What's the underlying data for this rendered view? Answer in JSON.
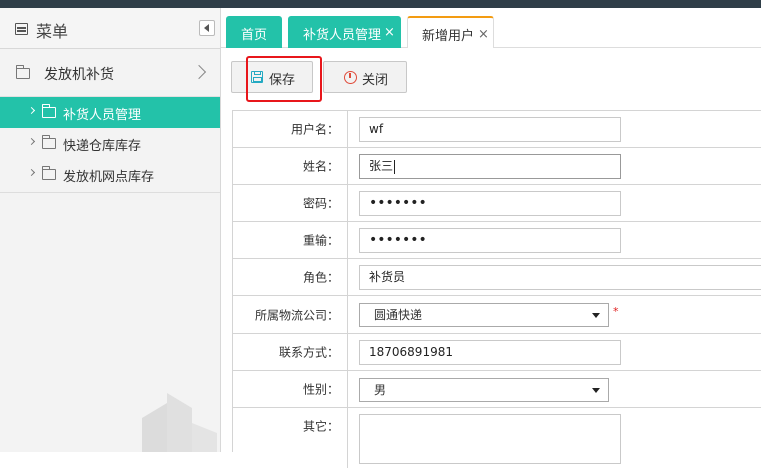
{
  "sidebar": {
    "title": "菜单",
    "group": {
      "label": "发放机补货"
    },
    "items": [
      {
        "label": "补货人员管理",
        "active": true
      },
      {
        "label": "快递仓库库存",
        "active": false
      },
      {
        "label": "发放机网点库存",
        "active": false
      }
    ]
  },
  "tabs": [
    {
      "label": "首页"
    },
    {
      "label": "补货人员管理",
      "close": "×"
    },
    {
      "label": "新增用户",
      "close": "×"
    }
  ],
  "toolbar": {
    "save_label": "保存",
    "close_label": "关闭"
  },
  "form": {
    "username": {
      "label": "用户名：",
      "value": "wf"
    },
    "name": {
      "label": "姓名：",
      "value": "张三"
    },
    "password": {
      "label": "密码：",
      "value": "•••••••"
    },
    "repeat": {
      "label": "重输：",
      "value": "•••••••"
    },
    "role": {
      "label": "角色：",
      "value": "补货员"
    },
    "company": {
      "label": "所属物流公司：",
      "value": "圆通快递",
      "required": "*"
    },
    "contact": {
      "label": "联系方式：",
      "value": "18706891981"
    },
    "gender": {
      "label": "性别：",
      "value": "男"
    },
    "other": {
      "label": "其它：",
      "value": ""
    }
  },
  "colors": {
    "accent": "#23c2a9",
    "topbar": "#2f3e48",
    "active_tab_border": "#f39c12",
    "highlight": "#e8161b"
  }
}
